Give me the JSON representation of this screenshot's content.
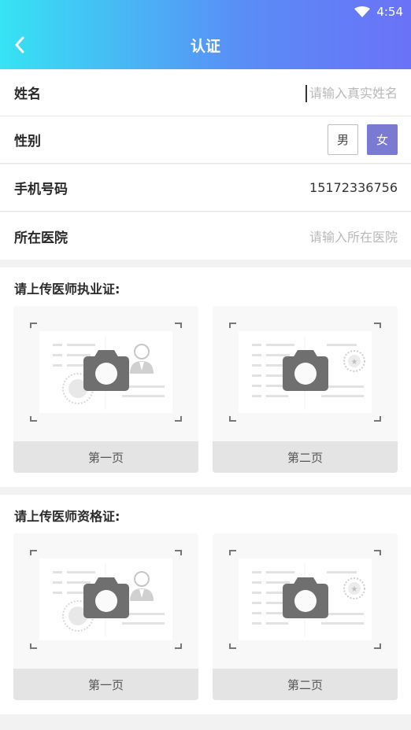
{
  "status_bar": {
    "time": "4:54"
  },
  "header": {
    "title": "认证"
  },
  "form": {
    "name": {
      "label": "姓名",
      "placeholder": "请输入真实姓名"
    },
    "gender": {
      "label": "性别",
      "options": [
        "男",
        "女"
      ],
      "selected": "女"
    },
    "phone": {
      "label": "手机号码",
      "value": "15172336756"
    },
    "hospital": {
      "label": "所在医院",
      "placeholder": "请输入所在医院"
    }
  },
  "practice_license": {
    "title": "请上传医师执业证:",
    "cards": [
      {
        "caption": "第一页"
      },
      {
        "caption": "第二页"
      }
    ]
  },
  "qualification_certificate": {
    "title": "请上传医师资格证:",
    "cards": [
      {
        "caption": "第一页"
      },
      {
        "caption": "第二页"
      }
    ]
  },
  "colors": {
    "header_start": "#36e3f3",
    "header_end": "#6a72f7",
    "accent": "#7b7ad3"
  }
}
